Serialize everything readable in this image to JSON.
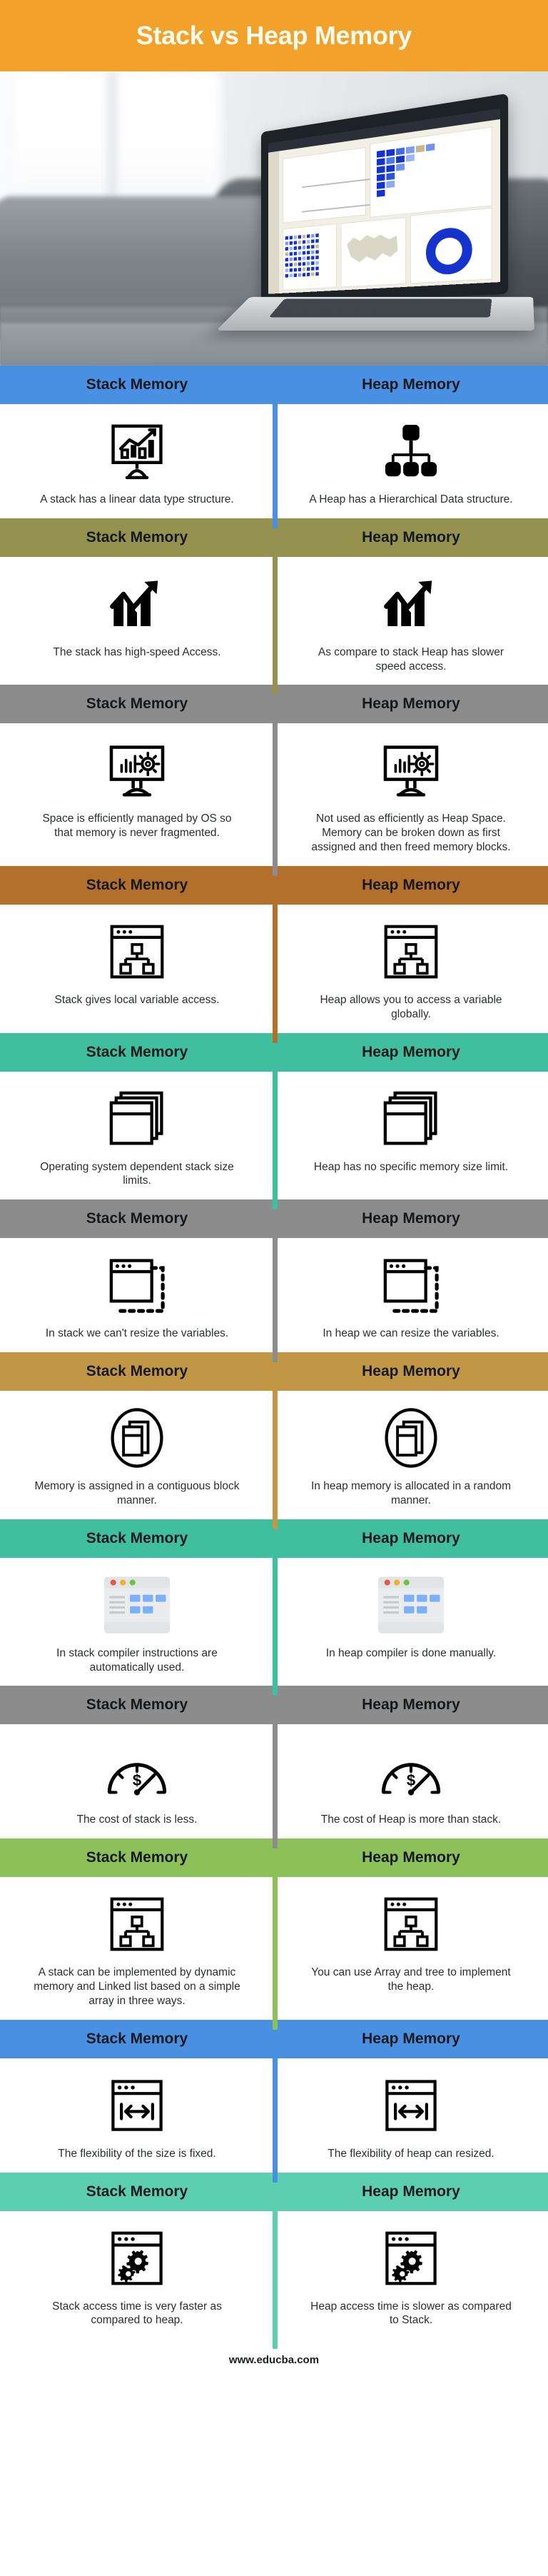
{
  "header": {
    "title": "Stack vs Heap Memory",
    "bg": "#f2a12a",
    "text_color": "#fdfbf0"
  },
  "hero": {
    "alt": "laptop-photo-icon"
  },
  "column_labels": {
    "left": "Stack Memory",
    "right": "Heap Memory"
  },
  "footer": {
    "url": "www.educba.com"
  },
  "rows": [
    {
      "band_color": "#4a90e2",
      "left_icon": "presentation-bar-chart-icon",
      "right_icon": "hierarchy-tree-icon",
      "left_text": "A stack has a linear data type structure.",
      "right_text": "A Heap has a Hierarchical Data structure."
    },
    {
      "band_color": "#95924f",
      "left_icon": "growth-arrow-bars-icon",
      "right_icon": "growth-arrow-bars-icon",
      "left_text": "The stack has high-speed Access.",
      "right_text": "As compare to stack Heap has slower speed access."
    },
    {
      "band_color": "#8c8c8c",
      "left_icon": "monitor-settings-icon",
      "right_icon": "monitor-settings-icon",
      "left_text": "Space is efficiently managed by OS so that memory is never fragmented.",
      "right_text": "Not used as efficiently as Heap Space. Memory can be broken down as first assigned and then freed memory blocks."
    },
    {
      "band_color": "#b3702a",
      "left_icon": "browser-sitemap-icon",
      "right_icon": "browser-sitemap-icon",
      "left_text": "Stack gives local variable access.",
      "right_text": "Heap allows you to access a variable globally."
    },
    {
      "band_color": "#3fbfa0",
      "left_icon": "stacked-layers-icon",
      "right_icon": "stacked-layers-icon",
      "left_text": "Operating system dependent stack size limits.",
      "right_text": "Heap has no specific memory size limit."
    },
    {
      "band_color": "#8c8c8c",
      "left_icon": "browser-resize-dashed-icon",
      "right_icon": "browser-resize-dashed-icon",
      "left_text": "In stack we can't resize the variables.",
      "right_text": "In heap we can resize the variables."
    },
    {
      "band_color": "#c19645",
      "left_icon": "circle-blocks-icon",
      "right_icon": "circle-blocks-icon",
      "left_text": "Memory is assigned in a contiguous block manner.",
      "right_text": "In heap memory is allocated in a random manner."
    },
    {
      "band_color": "#3fbfa0",
      "left_icon": "dashboard-window-color-icon",
      "right_icon": "dashboard-window-color-icon",
      "left_text": "In stack compiler instructions are automatically used.",
      "right_text": "In heap compiler is done manually."
    },
    {
      "band_color": "#8c8c8c",
      "left_icon": "cost-gauge-icon",
      "right_icon": "cost-gauge-icon",
      "left_text": "The cost of stack is less.",
      "right_text": "The cost of Heap is more than stack."
    },
    {
      "band_color": "#8cc059",
      "left_icon": "browser-sitemap-icon",
      "right_icon": "browser-sitemap-icon",
      "left_text": "A stack can be implemented by dynamic memory and Linked list based on a simple array in three ways.",
      "right_text": "You can use Array and tree to implement the heap."
    },
    {
      "band_color": "#4a90e2",
      "left_icon": "browser-arrows-width-icon",
      "right_icon": "browser-arrows-width-icon",
      "left_text": "The flexibility of the size is fixed.",
      "right_text": "The flexibility of heap can resized."
    },
    {
      "band_color": "#5ccfb0",
      "left_icon": "browser-gears-icon",
      "right_icon": "browser-gears-icon",
      "left_text": "Stack access time is very faster as compared to heap.",
      "right_text": "Heap access time is slower as compared to Stack."
    }
  ]
}
